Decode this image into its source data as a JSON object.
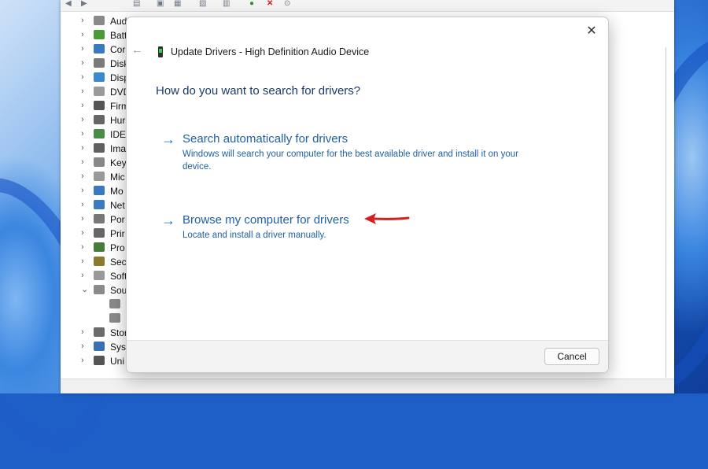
{
  "colors": {
    "accent": "#1f5fa3",
    "question": "#1a3a6b",
    "annotation_arrow": "#d42020"
  },
  "device_manager": {
    "toolbar_icons": [
      "back-icon",
      "forward-icon",
      "properties-icon",
      "help-icon",
      "update-icon",
      "scan-icon",
      "uninstall-icon",
      "disable-icon",
      "install-icon"
    ],
    "tree": [
      {
        "label": "Aud",
        "icon": "speaker-icon",
        "chevron": "›"
      },
      {
        "label": "Batt",
        "icon": "battery-icon",
        "chevron": "›"
      },
      {
        "label": "Cor",
        "icon": "monitor-icon",
        "chevron": "›"
      },
      {
        "label": "Disk",
        "icon": "disk-icon",
        "chevron": "›"
      },
      {
        "label": "Disp",
        "icon": "display-icon",
        "chevron": "›"
      },
      {
        "label": "DVD",
        "icon": "dvd-icon",
        "chevron": "›"
      },
      {
        "label": "Firm",
        "icon": "firmware-icon",
        "chevron": "›"
      },
      {
        "label": "Hur",
        "icon": "hid-icon",
        "chevron": "›"
      },
      {
        "label": "IDE",
        "icon": "ide-icon",
        "chevron": "›"
      },
      {
        "label": "Ima",
        "icon": "camera-icon",
        "chevron": "›"
      },
      {
        "label": "Key",
        "icon": "keyboard-icon",
        "chevron": "›"
      },
      {
        "label": "Mic",
        "icon": "mouse-icon",
        "chevron": "›"
      },
      {
        "label": "Mo",
        "icon": "monitor-icon",
        "chevron": "›"
      },
      {
        "label": "Net",
        "icon": "network-icon",
        "chevron": "›"
      },
      {
        "label": "Por",
        "icon": "port-icon",
        "chevron": "›"
      },
      {
        "label": "Prir",
        "icon": "printer-icon",
        "chevron": "›"
      },
      {
        "label": "Pro",
        "icon": "processor-icon",
        "chevron": "›"
      },
      {
        "label": "Sec",
        "icon": "security-icon",
        "chevron": "›"
      },
      {
        "label": "Soft",
        "icon": "software-icon",
        "chevron": "›"
      },
      {
        "label": "Sou",
        "icon": "speaker-icon",
        "chevron": "⌄"
      },
      {
        "label": "",
        "icon": "speaker-icon",
        "chevron": ""
      },
      {
        "label": "",
        "icon": "speaker-icon",
        "chevron": ""
      },
      {
        "label": "Stor",
        "icon": "storage-icon",
        "chevron": "›"
      },
      {
        "label": "Syst",
        "icon": "system-icon",
        "chevron": "›"
      },
      {
        "label": "Uni",
        "icon": "usb-icon",
        "chevron": "›"
      }
    ]
  },
  "dialog": {
    "title": "Update Drivers - High Definition Audio Device",
    "close_glyph": "✕",
    "back_glyph": "←",
    "question": "How do you want to search for drivers?",
    "options": [
      {
        "arrow": "→",
        "title": "Search automatically for drivers",
        "description": "Windows will search your computer for the best available driver and install it on your device."
      },
      {
        "arrow": "→",
        "title": "Browse my computer for drivers",
        "description": "Locate and install a driver manually."
      }
    ],
    "cancel_label": "Cancel"
  }
}
